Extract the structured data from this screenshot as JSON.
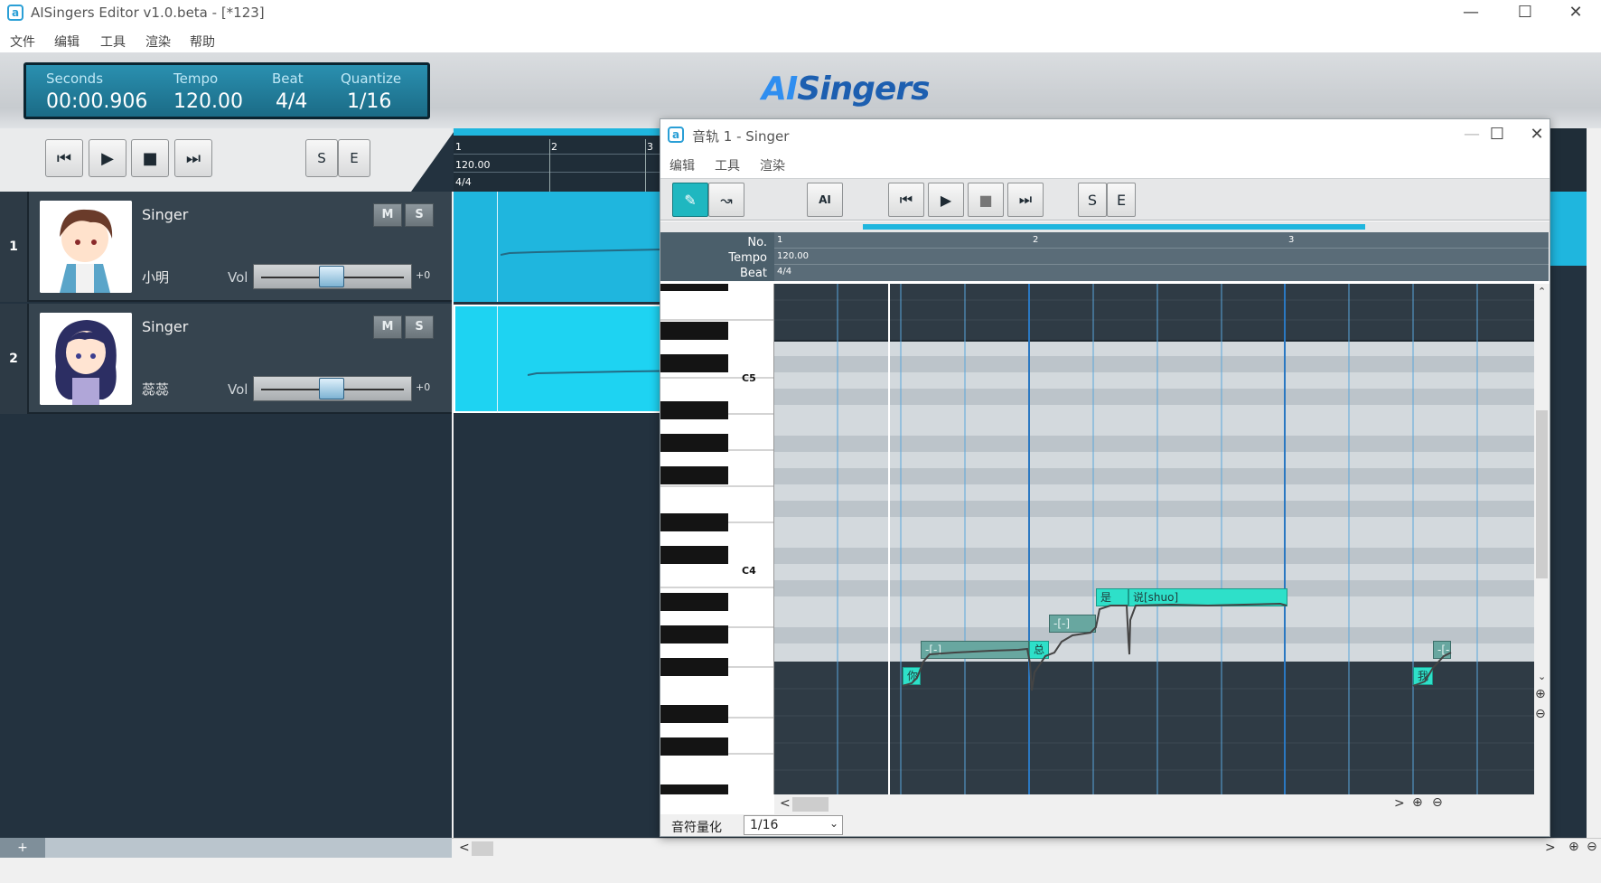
{
  "window": {
    "title": "AISingers Editor v1.0.beta - [*123]",
    "icon": "app-logo-icon",
    "controls": [
      "minimize-icon",
      "maximize-icon",
      "close-icon"
    ]
  },
  "menu": [
    "文件",
    "编辑",
    "工具",
    "渲染",
    "帮助"
  ],
  "status": {
    "seconds_label": "Seconds",
    "seconds_value": "00:00.906",
    "tempo_label": "Tempo",
    "tempo_value": "120.00",
    "beat_label": "Beat",
    "beat_value": "4/4",
    "quantize_label": "Quantize",
    "quantize_value": "1/16"
  },
  "logo": {
    "ai": "AI",
    "rest": "Singers"
  },
  "main_ruler": {
    "bars": [
      "1",
      "2",
      "3"
    ],
    "tempo": "120.00",
    "beat": "4/4"
  },
  "tracks": [
    {
      "number": "1",
      "singer": "Singer",
      "voice": "小明",
      "mute": "M",
      "solo": "S",
      "vol_label": "Vol",
      "vol_value": "+0",
      "volume_level": 0.5
    },
    {
      "number": "2",
      "singer": "Singer",
      "voice": "蕊蕊",
      "mute": "M",
      "solo": "S",
      "vol_label": "Vol",
      "vol_value": "+0",
      "volume_level": 0.5
    }
  ],
  "bottom_add": "+",
  "sub_window": {
    "title": "音轨 1 - Singer",
    "menu": [
      "编辑",
      "工具",
      "渲染"
    ],
    "ruler_labels": {
      "no": "No.",
      "tempo": "Tempo",
      "beat": "Beat"
    },
    "bars": [
      "1",
      "2",
      "3"
    ],
    "tempo_value": "120.00",
    "beat_value": "4/4",
    "key_labels": {
      "c5": "C5",
      "c4": "C4"
    },
    "notes": [
      {
        "text": "你",
        "style": "hl"
      },
      {
        "text": "-[-]",
        "style": "gr"
      },
      {
        "text": "总",
        "style": "hl"
      },
      {
        "text": "-[-]",
        "style": "gr"
      },
      {
        "text": "是",
        "style": "hl"
      },
      {
        "text": "说[shuo]",
        "style": "hl"
      },
      {
        "text": "我",
        "style": "hl"
      },
      {
        "text": "-[-",
        "style": "gr"
      }
    ],
    "quantize_label": "音符量化",
    "quantize_value": "1/16"
  },
  "colors": {
    "accent": "#1fb6de",
    "note": "#2ee0c9",
    "note_muted": "#68a7a0",
    "panel": "#36444f"
  }
}
